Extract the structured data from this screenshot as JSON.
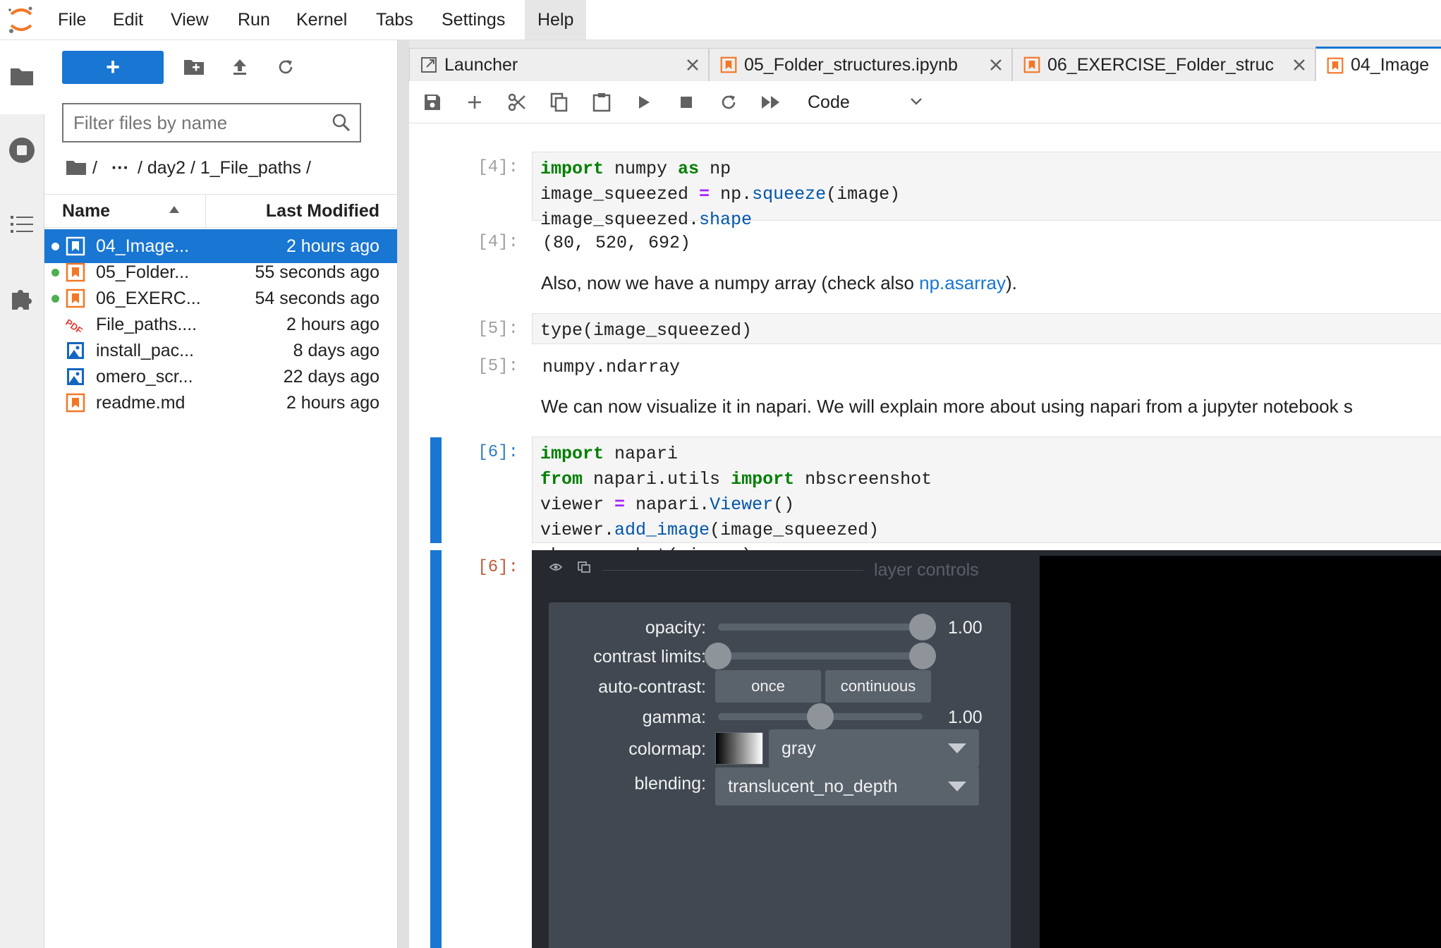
{
  "menu": {
    "items": [
      "File",
      "Edit",
      "View",
      "Run",
      "Kernel",
      "Tabs",
      "Settings",
      "Help"
    ],
    "active": "Help"
  },
  "filebrowser": {
    "new_button_label": "+",
    "filter_placeholder": "Filter files by name",
    "breadcrumb": [
      "/",
      "···",
      "/ day2 / 1_File_paths /"
    ],
    "columns": {
      "name": "Name",
      "modified": "Last Modified"
    },
    "files": [
      {
        "name": "04_Image...",
        "modified": "2 hours ago",
        "icon": "notebook-icon",
        "running": true,
        "selected": true
      },
      {
        "name": "05_Folder...",
        "modified": "55 seconds ago",
        "icon": "notebook-icon",
        "running": true,
        "selected": false
      },
      {
        "name": "06_EXERC...",
        "modified": "54 seconds ago",
        "icon": "notebook-icon",
        "running": true,
        "selected": false
      },
      {
        "name": "File_paths....",
        "modified": "2 hours ago",
        "icon": "pdf-icon",
        "running": false,
        "selected": false
      },
      {
        "name": "install_pac...",
        "modified": "8 days ago",
        "icon": "image-icon",
        "running": false,
        "selected": false
      },
      {
        "name": "omero_scr...",
        "modified": "22 days ago",
        "icon": "image-icon",
        "running": false,
        "selected": false
      },
      {
        "name": "readme.md",
        "modified": "2 hours ago",
        "icon": "markdown-icon",
        "running": false,
        "selected": false
      }
    ]
  },
  "tabs": [
    {
      "label": "Launcher",
      "icon": "launcher-icon",
      "active": false
    },
    {
      "label": "05_Folder_structures.ipynb",
      "icon": "notebook-icon",
      "active": false
    },
    {
      "label": "06_EXERCISE_Folder_struc",
      "icon": "notebook-icon",
      "active": false
    },
    {
      "label": "04_Image",
      "icon": "notebook-icon",
      "active": true
    }
  ],
  "toolbar": {
    "cell_type": "Code"
  },
  "cells": {
    "c4": {
      "in_prompt": "[4]:",
      "out_prompt": "[4]:",
      "line1": {
        "kw1": "import",
        "t1": " numpy ",
        "kw2": "as",
        "t2": " np"
      },
      "line2": {
        "t1": "image_squeezed ",
        "op": "=",
        "t2": " np.",
        "attr": "squeeze",
        "t3": "(image)"
      },
      "line3": {
        "t1": "image_squeezed.",
        "attr": "shape"
      },
      "output": "(80, 520, 692)"
    },
    "md1": {
      "before": "Also, now we have a numpy array (check also ",
      "link": "np.asarray",
      "after": ")."
    },
    "c5": {
      "in_prompt": "[5]:",
      "out_prompt": "[5]:",
      "code": "type(image_squeezed)",
      "output": "numpy.ndarray"
    },
    "md2": {
      "text": "We can now visualize it in napari. We will explain more about using napari from a jupyter notebook s"
    },
    "c6": {
      "in_prompt": "[6]:",
      "out_prompt": "[6]:",
      "line1": {
        "kw": "import",
        "t": " napari"
      },
      "line2": {
        "kw1": "from",
        "t1": " napari.utils ",
        "kw2": "import",
        "t2": " nbscreenshot"
      },
      "line3": {
        "t1": "viewer ",
        "op": "=",
        "t2": " napari.",
        "attr": "Viewer",
        "t3": "()"
      },
      "line4": {
        "t1": "viewer.",
        "attr": "add_image",
        "t2": "(image_squeezed)"
      },
      "line5": {
        "t": "nbscreenshot(viewer)"
      }
    }
  },
  "napari": {
    "header": "layer controls",
    "opacity_label": "opacity:",
    "opacity": 1.0,
    "opacity_text": "1.00",
    "contrast_label": "contrast limits:",
    "contrast_range": [
      0.0,
      1.0
    ],
    "autocontrast_label": "auto-contrast:",
    "btn_once": "once",
    "btn_continuous": "continuous",
    "gamma_label": "gamma:",
    "gamma": 0.5,
    "gamma_text": "1.00",
    "colormap_label": "colormap:",
    "colormap": "gray",
    "blending_label": "blending:",
    "blending": "translucent_no_depth"
  },
  "colors": {
    "accent": "#1976d2",
    "notebook_orange": "#f37726",
    "keyword": "#008000",
    "operator": "#aa22ff",
    "attribute": "#0055aa",
    "running_dot": "#4caf50"
  }
}
